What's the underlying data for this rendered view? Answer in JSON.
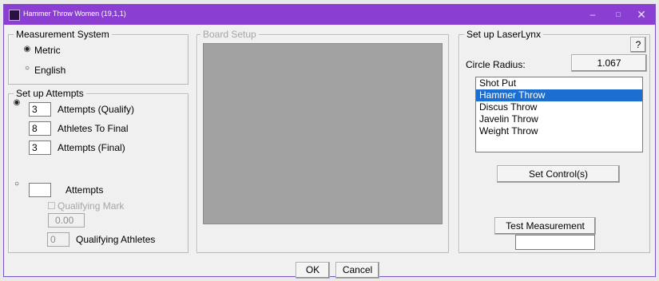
{
  "window": {
    "title": "Hammer Throw Women (19,1,1)",
    "min_glyph": "–",
    "max_glyph": "□",
    "close_glyph": "✕"
  },
  "measurement": {
    "legend": "Measurement System",
    "options": [
      {
        "label": "Metric",
        "selected": true
      },
      {
        "label": "English",
        "selected": false
      }
    ]
  },
  "attempts": {
    "legend": "Set up Attempts",
    "qualify_value": "3",
    "qualify_label": "Attempts (Qualify)",
    "athletes_value": "8",
    "athletes_label": "Athletes To Final",
    "final_value": "3",
    "final_label": "Attempts (Final)",
    "alt_value": "",
    "alt_label": "Attempts",
    "qual_mark_label": "Qualifying Mark",
    "qual_mark_value": "0.00",
    "qual_athletes_value": "0",
    "qual_athletes_label": "Qualifying Athletes"
  },
  "board": {
    "legend": "Board Setup"
  },
  "laserlynx": {
    "legend": "Set up LaserLynx",
    "help_label": "?",
    "radius_label": "Circle Radius:",
    "radius_value": "1.067",
    "events": [
      "Shot Put",
      "Hammer Throw",
      "Discus Throw",
      "Javelin Throw",
      "Weight Throw"
    ],
    "selected_event": "Hammer Throw",
    "set_controls_label": "Set Control(s)",
    "test_label": "Test Measurement",
    "test_result": ""
  },
  "footer": {
    "ok_label": "OK",
    "cancel_label": "Cancel"
  },
  "colors": {
    "title_bar": "#8b3fd2",
    "selection": "#1c6fd0",
    "board_area": "#a2a2a2"
  }
}
